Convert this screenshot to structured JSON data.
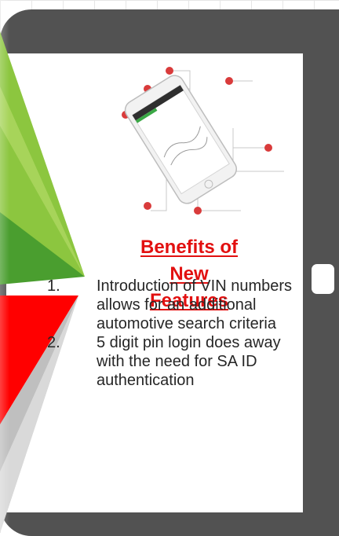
{
  "slide": {
    "heading_lines": [
      "Benefits of",
      "New",
      "Features"
    ],
    "features": [
      {
        "number": "1.",
        "text": "Introduction of VIN numbers allows for an additional automotive search criteria"
      },
      {
        "number": "2.",
        "text": "5 digit pin login does away with the need for SA ID authentication"
      }
    ]
  },
  "colors": {
    "heading": "#e21010",
    "tablet_frame": "#525252",
    "green_light": "#8cc63f",
    "green_dark": "#4a9e2f",
    "red": "#ff0000"
  }
}
